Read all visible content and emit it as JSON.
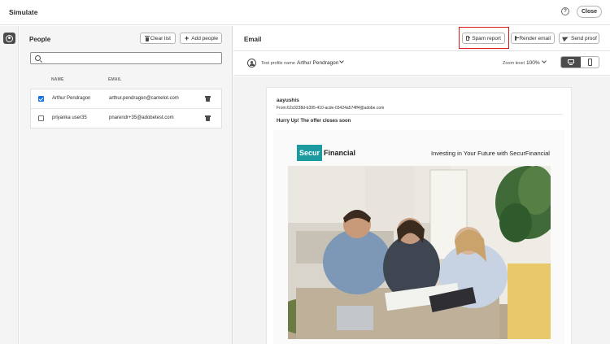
{
  "app": {
    "title": "Simulate",
    "help_icon": "help-icon",
    "close_label": "Close"
  },
  "people": {
    "title": "People",
    "clear_label": "Clear list",
    "add_label": "Add people",
    "search_placeholder": "",
    "columns": {
      "name": "NAME",
      "email": "EMAIL"
    },
    "rows": [
      {
        "checked": true,
        "name": "Arthur Pendragon",
        "email": "arthur.pendragon@camelot.com"
      },
      {
        "checked": false,
        "name": "priyanka user35",
        "email": "pnarendr+35@adobetest.com"
      }
    ]
  },
  "email": {
    "title": "Email",
    "spam_label": "Spam report",
    "render_label": "Render email",
    "send_label": "Send proof",
    "test_profile_label": "Test profile name",
    "test_profile_value": "Arthur Pendragon",
    "zoom_label": "Zoom level",
    "zoom_value": "100%",
    "view_modes": [
      "desktop",
      "mobile"
    ],
    "view_mode_selected": "desktop"
  },
  "preview": {
    "sender": "aayushis",
    "from": "From:62c0238d-b395-410-acde-03424a574ff4@adobe.com",
    "subject": "Hurry Up! The offer closes soon",
    "logo_mark": "Secur",
    "logo_rest": "Financial",
    "tagline": "Investing in Your Future with SecurFinancial",
    "image_description": "photo of three people looking at documents on a sofa"
  },
  "colors": {
    "accent": "#1473e6",
    "logo_teal": "#1b9aa0",
    "highlight": "#d7191c"
  }
}
